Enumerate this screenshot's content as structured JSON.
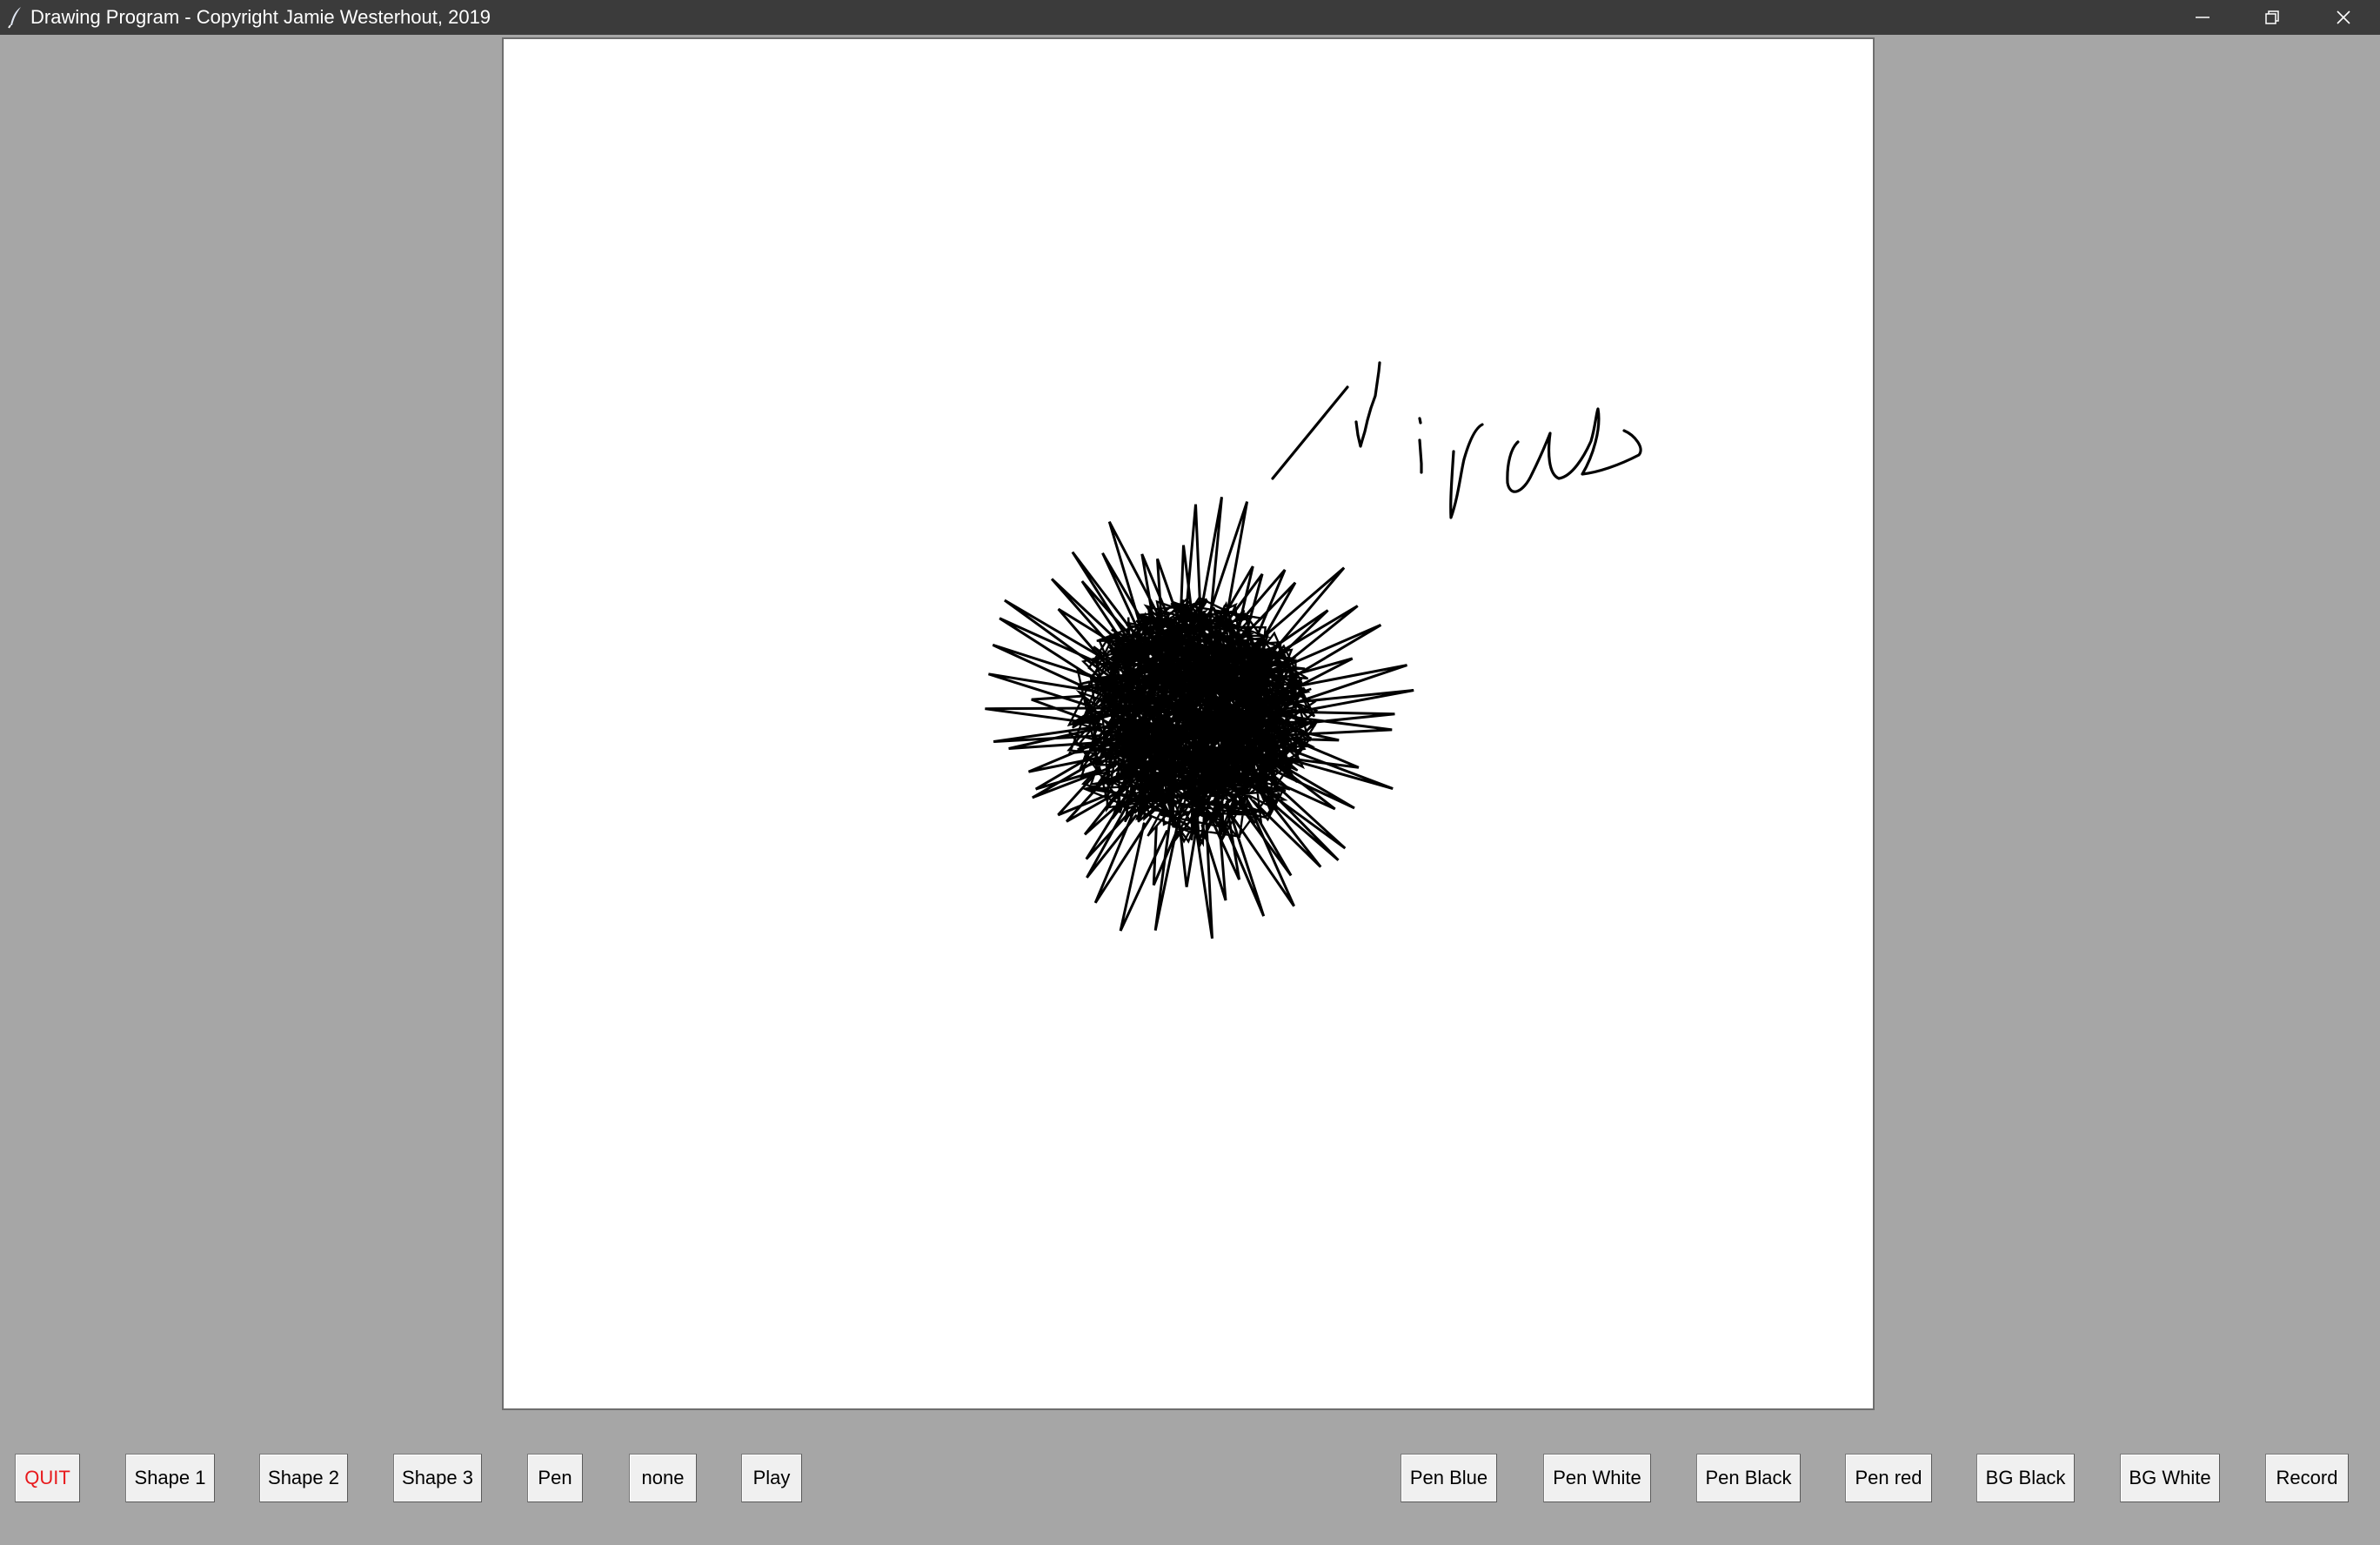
{
  "window": {
    "title": "Drawing Program - Copyright Jamie Westerhout, 2019",
    "titlebar_color": "#3b3b3b",
    "background_color": "#a6a6a6"
  },
  "canvas": {
    "background_color": "#ffffff",
    "pen_color": "#000000"
  },
  "toolbar": {
    "quit_label": "QUIT",
    "quit_color": "#e8191c",
    "shape1_label": "Shape 1",
    "shape2_label": "Shape 2",
    "shape3_label": "Shape 3",
    "pen_label": "Pen",
    "none_label": "none",
    "play_label": "Play",
    "pen_blue_label": "Pen Blue",
    "pen_white_label": "Pen White",
    "pen_black_label": "Pen Black",
    "pen_red_label": "Pen red",
    "bg_black_label": "BG Black",
    "bg_white_label": "BG White",
    "record_label": "Record"
  },
  "icons": {
    "app": "feather-pen-icon",
    "minimize": "minimize-icon",
    "restore": "restore-icon",
    "close": "close-icon"
  }
}
